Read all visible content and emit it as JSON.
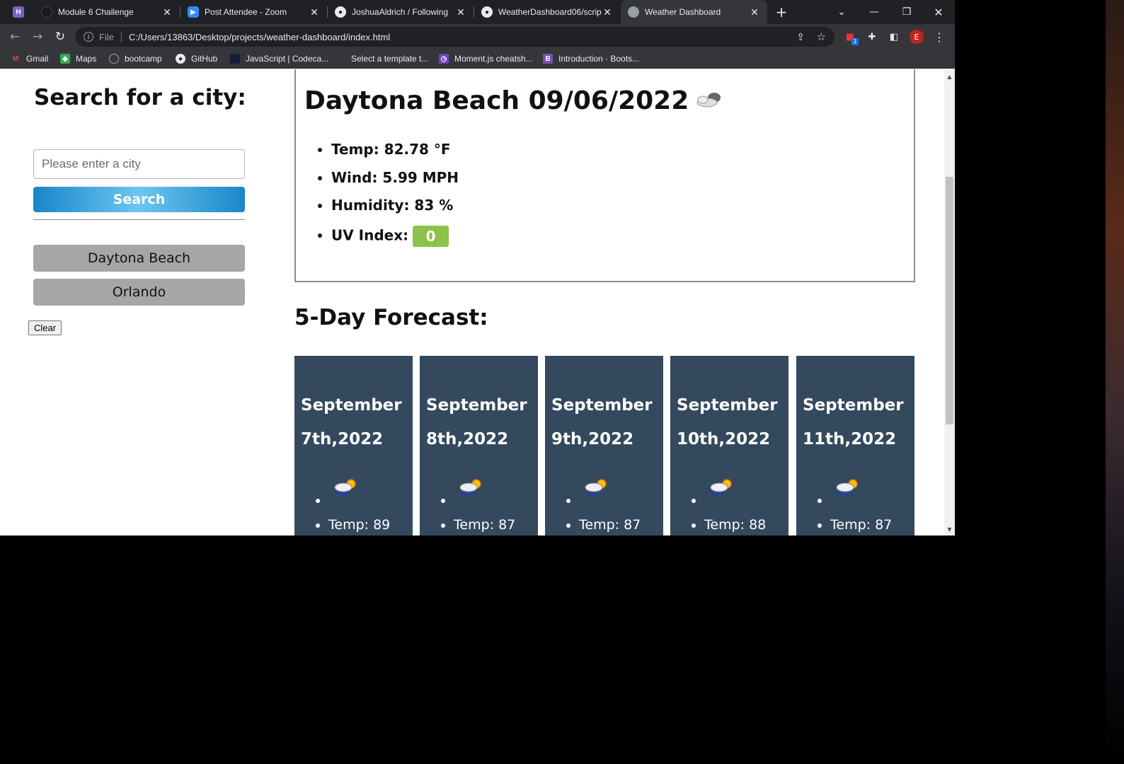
{
  "browser": {
    "tabs": [
      {
        "title": "Module 6 Challenge",
        "active": false
      },
      {
        "title": "Post Attendee - Zoom",
        "active": false
      },
      {
        "title": "JoshuaAldrich / Following",
        "active": false
      },
      {
        "title": "WeatherDashboard06/scrip",
        "active": false
      },
      {
        "title": "Weather Dashboard",
        "active": true
      }
    ],
    "address": {
      "scheme": "File",
      "url": "C:/Users/13863/Desktop/projects/weather-dashboard/index.html"
    },
    "profile_initial": "E",
    "extension_badge": "1",
    "bookmarks": [
      {
        "label": "Gmail",
        "icon": "gmail-icon"
      },
      {
        "label": "Maps",
        "icon": "maps-icon"
      },
      {
        "label": "bootcamp",
        "icon": "globe-icon"
      },
      {
        "label": "GitHub",
        "icon": "github-icon"
      },
      {
        "label": "JavaScript | Codeca...",
        "icon": "codecademy-icon"
      },
      {
        "label": "Select a template t...",
        "icon": "page-icon"
      },
      {
        "label": "Moment.js cheatsh...",
        "icon": "moment-icon"
      },
      {
        "label": "Introduction · Boots...",
        "icon": "bootstrap-icon"
      }
    ]
  },
  "sidebar": {
    "title": "Search for a city:",
    "search_placeholder": "Please enter a city",
    "search_button": "Search",
    "history": [
      "Daytona Beach",
      "Orlando"
    ],
    "clear_button": "Clear"
  },
  "current": {
    "title": "Daytona Beach 09/06/2022",
    "icon": "cloudy-icon",
    "temp": "Temp: 82.78 °F",
    "wind": "Wind: 5.99 MPH",
    "humidity": "Humidity: 83 %",
    "uv_label": "UV Index:",
    "uv_value": "0",
    "uv_color": "#8bc34a"
  },
  "forecast": {
    "title": "5-Day Forecast:",
    "card_color": "#34495e",
    "days": [
      {
        "date_line1": "September",
        "date_line2": "7th,2022",
        "icon": "sun-rain-icon",
        "temp": "Temp: 89"
      },
      {
        "date_line1": "September",
        "date_line2": "8th,2022",
        "icon": "sun-rain-icon",
        "temp": "Temp: 87"
      },
      {
        "date_line1": "September",
        "date_line2": "9th,2022",
        "icon": "sun-rain-icon",
        "temp": "Temp: 87"
      },
      {
        "date_line1": "September",
        "date_line2": "10th,2022",
        "icon": "sun-rain-icon",
        "temp": "Temp: 88"
      },
      {
        "date_line1": "September",
        "date_line2": "11th,2022",
        "icon": "sun-rain-icon",
        "temp": "Temp: 87"
      }
    ]
  }
}
